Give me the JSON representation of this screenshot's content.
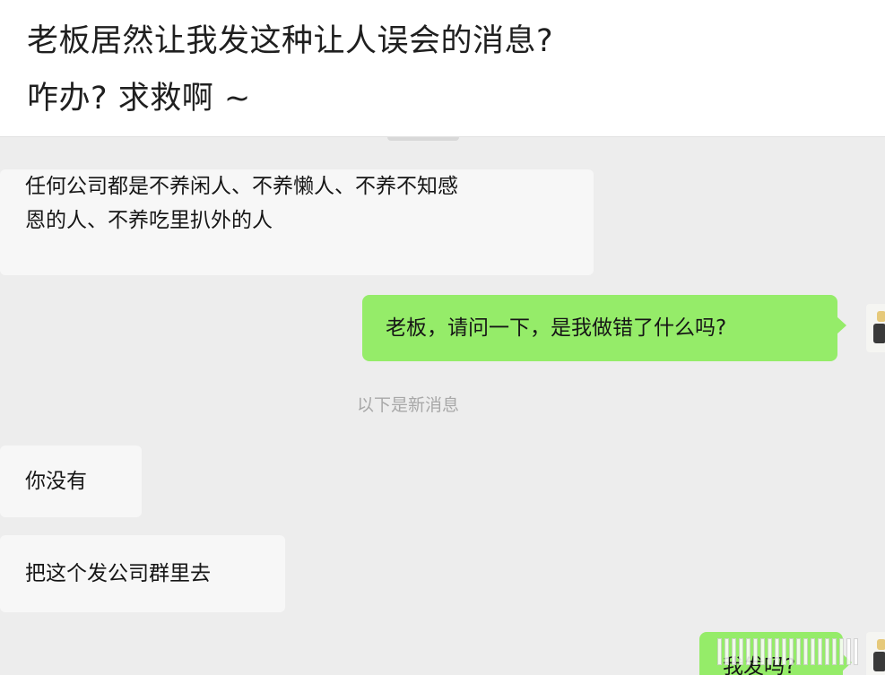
{
  "post": {
    "line1": "老板居然让我发这种让人误会的消息?",
    "line2": "咋办? 求救啊 ~"
  },
  "chat": {
    "messages": [
      {
        "side": "in",
        "lines": [
          "任何公司都是不养闲人、不养懒人、不养不知感",
          "恩的人、不养吃里扒外的人"
        ]
      },
      {
        "side": "out",
        "text": "老板，请问一下，是我做错了什么吗?"
      },
      {
        "side": "in",
        "text": "你没有"
      },
      {
        "side": "in",
        "text": "把这个发公司群里去"
      },
      {
        "side": "out",
        "text": "我发吗?"
      }
    ],
    "system_note": "以下是新消息"
  },
  "colors": {
    "chat_background": "#ededed",
    "incoming_bubble": "#f7f7f7",
    "outgoing_bubble": "#95ec69",
    "system_note": "#a8a8a8"
  },
  "icons": {
    "avatar": "user-avatar-icon"
  }
}
